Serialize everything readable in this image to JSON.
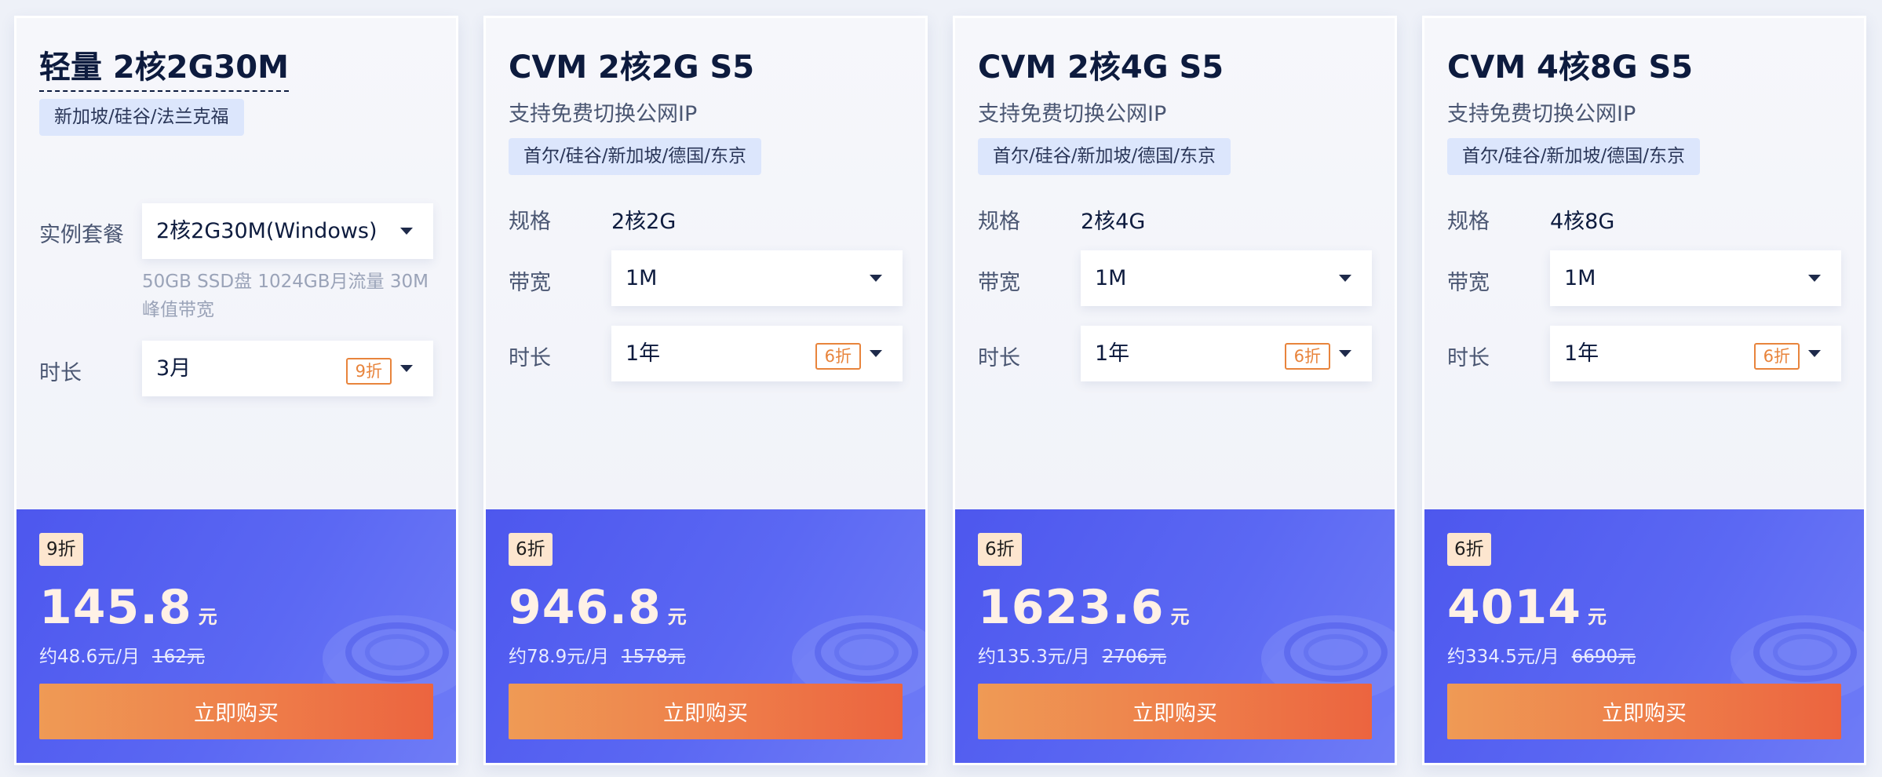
{
  "cards": [
    {
      "title": "轻量 2核2G30M",
      "region": "新加坡/硅谷/法兰克福",
      "plan_label": "实例套餐",
      "plan_value": "2核2G30M(Windows)",
      "plan_note": "50GB SSD盘 1024GB月流量 30M峰值带宽",
      "duration_label": "时长",
      "duration_value": "3月",
      "duration_badge": "9折",
      "discount_badge": "9折",
      "price": "145.8",
      "price_unit": "元",
      "per_month": "约48.6元/月",
      "original_price": "162元",
      "buy_label": "立即购买"
    },
    {
      "title": "CVM 2核2G S5",
      "subtitle": "支持免费切换公网IP",
      "region": "首尔/硅谷/新加坡/德国/东京",
      "spec_label": "规格",
      "spec_value": "2核2G",
      "bandwidth_label": "带宽",
      "bandwidth_value": "1M",
      "duration_label": "时长",
      "duration_value": "1年",
      "duration_badge": "6折",
      "discount_badge": "6折",
      "price": "946.8",
      "price_unit": "元",
      "per_month": "约78.9元/月",
      "original_price": "1578元",
      "buy_label": "立即购买"
    },
    {
      "title": "CVM 2核4G S5",
      "subtitle": "支持免费切换公网IP",
      "region": "首尔/硅谷/新加坡/德国/东京",
      "spec_label": "规格",
      "spec_value": "2核4G",
      "bandwidth_label": "带宽",
      "bandwidth_value": "1M",
      "duration_label": "时长",
      "duration_value": "1年",
      "duration_badge": "6折",
      "discount_badge": "6折",
      "price": "1623.6",
      "price_unit": "元",
      "per_month": "约135.3元/月",
      "original_price": "2706元",
      "buy_label": "立即购买"
    },
    {
      "title": "CVM 4核8G S5",
      "subtitle": "支持免费切换公网IP",
      "region": "首尔/硅谷/新加坡/德国/东京",
      "spec_label": "规格",
      "spec_value": "4核8G",
      "bandwidth_label": "带宽",
      "bandwidth_value": "1M",
      "duration_label": "时长",
      "duration_value": "1年",
      "duration_badge": "6折",
      "discount_badge": "6折",
      "price": "4014",
      "price_unit": "元",
      "per_month": "约334.5元/月",
      "original_price": "6690元",
      "buy_label": "立即购买"
    }
  ],
  "icons": {
    "dropdown": "chevron-down-icon",
    "decoration": "server-disc-icon"
  },
  "colors": {
    "title": "#0d1b3e",
    "region_bg": "#dce6fc",
    "price_panel": "#5560f0",
    "buy_button_from": "#ef9a55",
    "buy_button_to": "#ec643f",
    "badge_outline": "#e8843c",
    "discount_badge_bg": "#fde6cf"
  }
}
